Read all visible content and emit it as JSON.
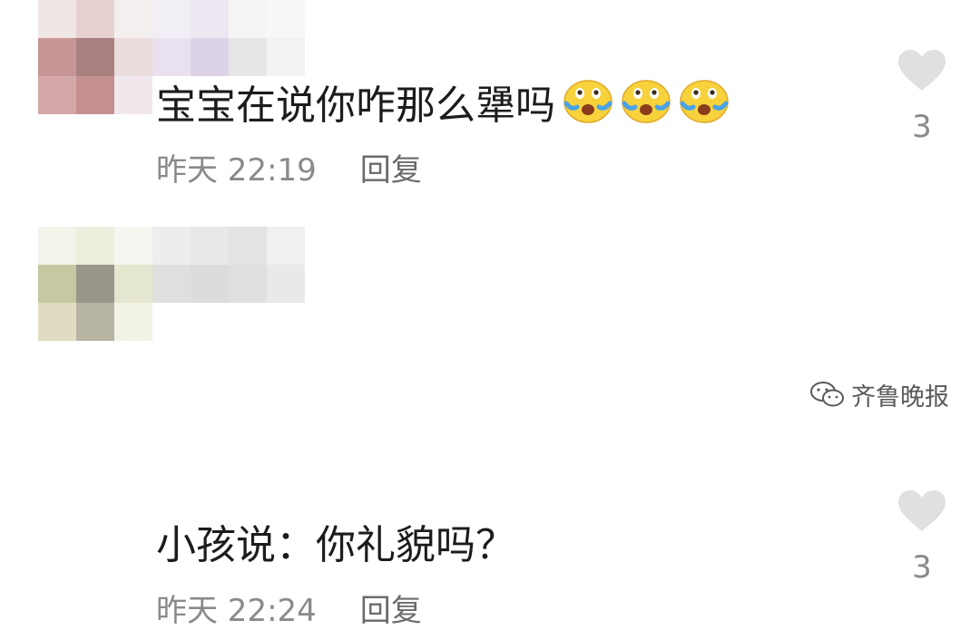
{
  "comments": [
    {
      "text": "宝宝在说你咋那么犟吗",
      "emojis": [
        "crying-laughing-emoji",
        "crying-laughing-emoji",
        "crying-laughing-emoji"
      ],
      "time": "昨天 22:19",
      "reply_label": "回复",
      "likes": "3"
    },
    {
      "text": "小孩说：你礼貌吗？",
      "emojis": [],
      "time": "昨天 22:24",
      "reply_label": "回复",
      "likes": "3"
    }
  ],
  "watermark": {
    "text": "齐鲁晚报",
    "icon": "wechat-icon"
  },
  "colors": {
    "text": "#1c1c1c",
    "meta": "#8a8a8a",
    "heart": "#e0e0e0",
    "avatar1_mosaic": [
      "#f0e6e6",
      "#e6d0d0",
      "#f3efef",
      "#c79595",
      "#a88080",
      "#eadcdc",
      "#d4a8a8",
      "#c49090",
      "#f1e8ee"
    ],
    "username1_mosaic": [
      "#f2eef5",
      "#ece7f1",
      "#f4f4f4",
      "#f7f7f7",
      "#e9e1ef",
      "#ddd3e6",
      "#e6e6e6",
      "#f2f2f2"
    ],
    "avatar2_mosaic": [
      "#f3f3ea",
      "#eeeedf",
      "#f6f6f0",
      "#c8c7a4",
      "#9a968a",
      "#e5e6d0",
      "#e0dcc3",
      "#b7b4a3",
      "#f2f2e6"
    ],
    "username2_mosaic": [
      "#ededed",
      "#e8e8e8",
      "#e3e3e3",
      "#f0f0f0",
      "#dfdfdf",
      "#dcdcdc",
      "#e0e0e0",
      "#e9e9e9"
    ]
  }
}
